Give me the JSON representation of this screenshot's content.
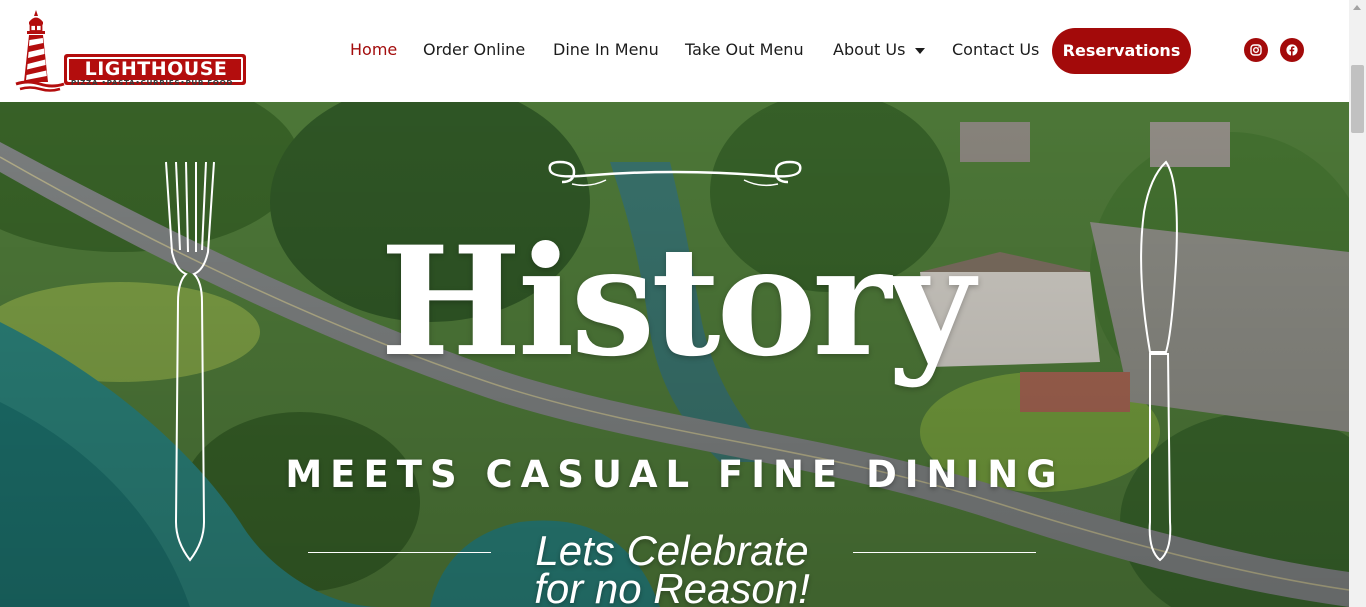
{
  "brand": {
    "name": "LIGHTHOUSE",
    "tagline": "PIZZA •PASTA•CURRIES•PUB FOOD",
    "logo_icon": "lighthouse-icon",
    "color": "#a30a0a"
  },
  "nav": {
    "items": [
      {
        "label": "Home",
        "active": true
      },
      {
        "label": "Order Online",
        "active": false
      },
      {
        "label": "Dine In Menu",
        "active": false
      },
      {
        "label": "Take Out Menu",
        "active": false
      },
      {
        "label": "About Us",
        "active": false,
        "has_dropdown": true,
        "dropdown_icon": "caret-down-icon"
      },
      {
        "label": "Contact Us",
        "active": false
      }
    ],
    "cta_label": "Reservations",
    "social": [
      {
        "icon": "instagram-icon"
      },
      {
        "icon": "facebook-icon"
      }
    ]
  },
  "hero": {
    "title": "History",
    "subtitle": "MEETS CASUAL FINE DINING",
    "script_line_1": "Lets Celebrate",
    "script_line_2": "for no Reason!",
    "decorations": [
      "fork-icon",
      "knife-icon",
      "flourish-icon"
    ],
    "background": "aerial view of restaurant by the water"
  }
}
